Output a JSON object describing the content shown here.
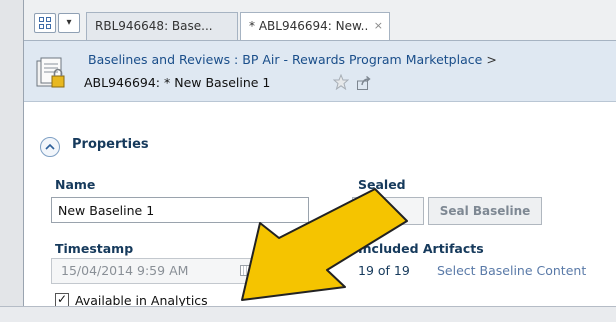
{
  "tabs": [
    {
      "label": "RBL946648: Base..."
    },
    {
      "label": "* ABL946694: New..",
      "close": "×"
    }
  ],
  "header": {
    "breadcrumb": "Baselines and Reviews : BP Air - Rewards Program Marketplace",
    "breadcrumb_separator": ">",
    "title": "ABL946694: * New Baseline 1"
  },
  "properties": {
    "title": "Properties",
    "name_label": "Name",
    "name_value": "New Baseline 1",
    "sealed_label": "Sealed",
    "seal_button": "Seal Baseline",
    "timestamp_label": "Timestamp",
    "timestamp_value": "15/04/2014 9:59 AM",
    "included_label": "Included Artifacts",
    "included_count": "19 of 19",
    "select_content_link": "Select Baseline Content",
    "analytics_checkbox": {
      "label": "Available in Analytics",
      "checked": true
    }
  },
  "annotation": {
    "type": "arrow",
    "color": "#f5c400",
    "points_to": "Available in Analytics"
  }
}
